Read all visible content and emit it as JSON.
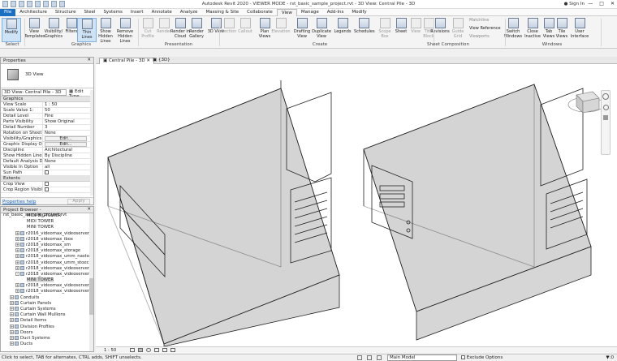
{
  "app": {
    "title": "Autodesk Revit 2020 - VIEWER MODE - rst_basic_sample_project.rvt - 3D View: Central Pile - 3D",
    "sign_in": "Sign In"
  },
  "tabs": [
    "File",
    "Architecture",
    "Structure",
    "Steel",
    "Systems",
    "Insert",
    "Annotate",
    "Analyze",
    "Massing & Site",
    "Collaborate",
    "View",
    "Manage",
    "Add-Ins",
    "Modify"
  ],
  "active_tab": "View",
  "ribbon": {
    "buttons": [
      {
        "label": "Modify",
        "state": "selected"
      },
      {
        "label": "View Templates",
        "state": "normal"
      },
      {
        "label": "Visibility/ Graphics",
        "state": "normal"
      },
      {
        "label": "Filters",
        "state": "normal"
      },
      {
        "label": "Thin Lines",
        "state": "selected"
      },
      {
        "label": "Show Hidden Lines",
        "state": "normal"
      },
      {
        "label": "Remove Hidden Lines",
        "state": "normal"
      },
      {
        "label": "Cut Profile",
        "state": "dim"
      },
      {
        "label": "Render",
        "state": "dim"
      },
      {
        "label": "Render in Cloud",
        "state": "normal"
      },
      {
        "label": "Render Gallery",
        "state": "normal"
      },
      {
        "label": "3D View",
        "state": "normal"
      },
      {
        "label": "Section",
        "state": "dim"
      },
      {
        "label": "Callout",
        "state": "dim"
      },
      {
        "label": "Plan Views",
        "state": "normal"
      },
      {
        "label": "Elevation",
        "state": "dim"
      },
      {
        "label": "Drafting View",
        "state": "normal"
      },
      {
        "label": "Duplicate View",
        "state": "normal"
      },
      {
        "label": "Legends",
        "state": "normal"
      },
      {
        "label": "Schedules",
        "state": "normal"
      },
      {
        "label": "Scope Box",
        "state": "dim"
      },
      {
        "label": "Sheet",
        "state": "normal"
      },
      {
        "label": "View",
        "state": "dim"
      },
      {
        "label": "Title Block",
        "state": "dim"
      },
      {
        "label": "Revisions",
        "state": "normal"
      },
      {
        "label": "Guide Grid",
        "state": "dim"
      },
      {
        "label": "Switch Windows",
        "state": "normal"
      },
      {
        "label": "Close Inactive",
        "state": "normal"
      },
      {
        "label": "Tab Views",
        "state": "normal"
      },
      {
        "label": "Tile Views",
        "state": "normal"
      },
      {
        "label": "User Interface",
        "state": "normal"
      }
    ],
    "small_buttons": [
      "Matchline",
      "View Reference",
      "Viewports"
    ],
    "panels": [
      "Select",
      "Graphics",
      "Presentation",
      "Create",
      "Sheet Composition",
      "Windows"
    ]
  },
  "properties": {
    "header": "Properties",
    "type_name": "3D View",
    "instance_selector": "3D View: Central Pile - 3D",
    "edit_type": "Edit Type",
    "groups": [
      {
        "name": "Graphics",
        "rows": [
          {
            "k": "View Scale",
            "v": "1 : 50"
          },
          {
            "k": "Scale Value    1:",
            "v": "50"
          },
          {
            "k": "Detail Level",
            "v": "Fine"
          },
          {
            "k": "Parts Visibility",
            "v": "Show Original"
          },
          {
            "k": "Detail Number",
            "v": "3"
          },
          {
            "k": "Rotation on Sheet",
            "v": "None"
          },
          {
            "k": "Visibility/Graphics O...",
            "v": "Edit...",
            "btn": true
          },
          {
            "k": "Graphic Display Opti...",
            "v": "Edit...",
            "btn": true
          },
          {
            "k": "Discipline",
            "v": "Architectural"
          },
          {
            "k": "Show Hidden Lines",
            "v": "By Discipline"
          },
          {
            "k": "Default Analysis Dis...",
            "v": "None"
          },
          {
            "k": "Visible In Option",
            "v": "all"
          },
          {
            "k": "Sun Path",
            "v": "",
            "cb": true
          }
        ]
      },
      {
        "name": "Extents",
        "rows": [
          {
            "k": "Crop View",
            "v": "",
            "cb": true
          },
          {
            "k": "Crop Region Visible",
            "v": "",
            "cb": true
          }
        ]
      }
    ],
    "help_link": "Properties help",
    "apply": "Apply"
  },
  "project_browser": {
    "header": "Project Browser - rst_basic_sample_project.rvt",
    "items": [
      {
        "t": "MIDI BIGTOWER",
        "lvl": 4,
        "pm": ""
      },
      {
        "t": "MIDI TOWER",
        "lvl": 4,
        "pm": ""
      },
      {
        "t": "MINI TOWER",
        "lvl": 4,
        "pm": ""
      },
      {
        "t": "r2016_videomax_videoserver_stoechn",
        "lvl": 2,
        "pm": "+"
      },
      {
        "t": "r2018_videomax_ibox",
        "lvl": 2,
        "pm": "+"
      },
      {
        "t": "r2018_videomax_sm",
        "lvl": 2,
        "pm": "+"
      },
      {
        "t": "r2018_videomax_storage",
        "lvl": 2,
        "pm": "+"
      },
      {
        "t": "r2018_videomax_umm_nastolnogo_isp",
        "lvl": 2,
        "pm": "+"
      },
      {
        "t": "r2018_videomax_umm_stoechnogo_isp",
        "lvl": 2,
        "pm": "+"
      },
      {
        "t": "r2018_videomax_videoserver_nastoln",
        "lvl": 2,
        "pm": "+"
      },
      {
        "t": "r2018_videomax_videoserver_nastoln",
        "lvl": 2,
        "pm": "-"
      },
      {
        "t": "MINI TOWER",
        "lvl": 4,
        "pm": "",
        "hl": true
      },
      {
        "t": "r2018_videomax_videoserver_stoechn",
        "lvl": 2,
        "pm": "+"
      },
      {
        "t": "r2018_videomax_videoserver_stoechn",
        "lvl": 2,
        "pm": "+"
      },
      {
        "t": "Conduits",
        "lvl": 1,
        "pm": "+"
      },
      {
        "t": "Curtain Panels",
        "lvl": 1,
        "pm": "+"
      },
      {
        "t": "Curtain Systems",
        "lvl": 1,
        "pm": "+"
      },
      {
        "t": "Curtain Wall Mullions",
        "lvl": 1,
        "pm": "+"
      },
      {
        "t": "Detail Items",
        "lvl": 1,
        "pm": "+"
      },
      {
        "t": "Division Profiles",
        "lvl": 1,
        "pm": "+"
      },
      {
        "t": "Doors",
        "lvl": 1,
        "pm": "+"
      },
      {
        "t": "Duct Systems",
        "lvl": 1,
        "pm": "+"
      },
      {
        "t": "Ducts",
        "lvl": 1,
        "pm": "+"
      }
    ]
  },
  "view_tabs": [
    {
      "label": "Central Pile - 3D",
      "active": true
    },
    {
      "label": "{3D}",
      "active": false
    }
  ],
  "view_control": {
    "scale": "1 : 50"
  },
  "status": {
    "message": "Click to select, TAB for alternates, CTRL adds, SHIFT unselects.",
    "model": "Main Model",
    "exclude": "Exclude Options",
    "filter": ":0"
  },
  "colors": {
    "file_tab": "#1b6fc2",
    "canvas_bg": "#ffffff",
    "model_fill": "#d3d3d3",
    "edge": "#222222"
  }
}
